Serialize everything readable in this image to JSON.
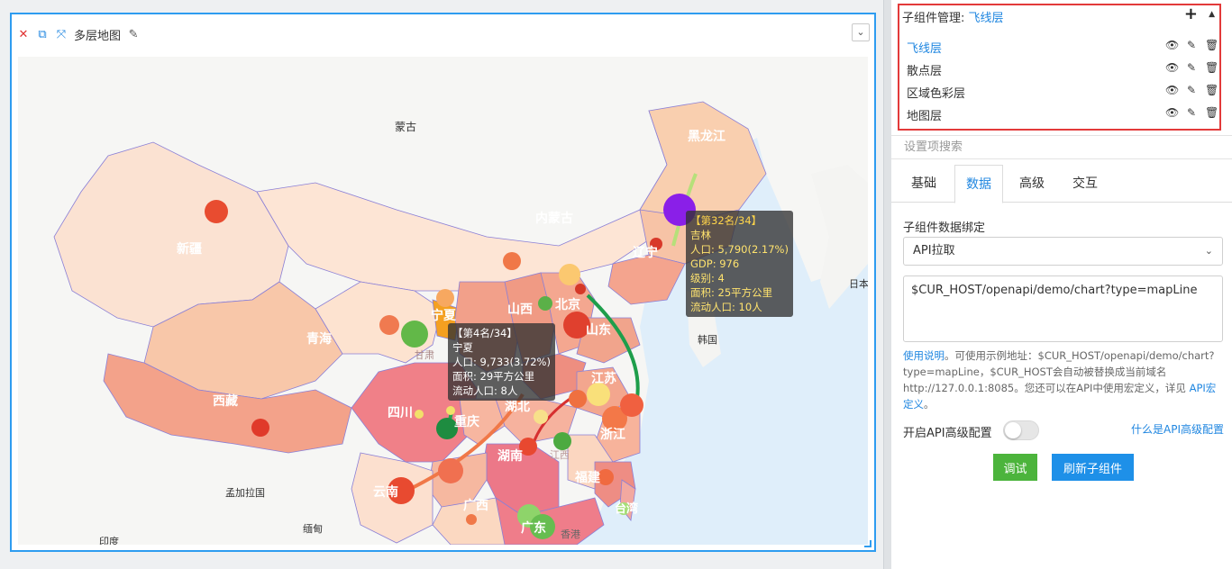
{
  "widget": {
    "title": "多层地图",
    "icons": {
      "close": "close-icon",
      "copy": "copy-icon",
      "fullscreen": "expand-icon",
      "edit": "pencil-icon",
      "collapse": "chevron-down-icon"
    }
  },
  "map": {
    "place_labels": [
      "蒙古",
      "新疆",
      "内蒙古",
      "黑龙江",
      "辽宁",
      "青海",
      "宁夏",
      "甘肃",
      "山西",
      "北京",
      "山东",
      "西藏",
      "四川",
      "重庆",
      "湖北",
      "江苏",
      "浙江",
      "湖南",
      "江西",
      "福建",
      "云南",
      "广西",
      "广东",
      "台湾",
      "香港",
      "日本",
      "韩国",
      "孟加拉国",
      "缅甸",
      "印度"
    ],
    "tooltips": [
      {
        "head": "【第32名/34】",
        "lines": [
          "吉林",
          "人口: 5,790(2.17%)",
          "GDP: 976",
          "级别: 4",
          "面积: 25平方公里",
          "流动人口: 10人"
        ]
      },
      {
        "head": "【第4名/34】",
        "lines": [
          "宁夏",
          "人口: 9,733(3.72%)",
          "面积: 29平方公里",
          "流动人口: 8人"
        ]
      }
    ]
  },
  "panel": {
    "sub_manager": {
      "label": "子组件管理:",
      "current": "飞线层",
      "icons": {
        "add": "plus-icon",
        "sort": "caret-up-icon",
        "view": "eye-icon",
        "edit": "edit-icon",
        "delete": "trash-icon"
      },
      "layers": [
        {
          "name": "飞线层",
          "active": true
        },
        {
          "name": "散点层",
          "active": false
        },
        {
          "name": "区域色彩层",
          "active": false
        },
        {
          "name": "地图层",
          "active": false
        }
      ]
    },
    "search_placeholder": "设置项搜索",
    "tabs": [
      "基础",
      "数据",
      "高级",
      "交互"
    ],
    "active_tab": "数据",
    "bind_label": "子组件数据绑定",
    "bind_select": "API拉取",
    "api_url": "$CUR_HOST/openapi/demo/chart?type=mapLine",
    "help_link": "使用说明",
    "help_text": "。可使用示例地址：$CUR_HOST/openapi/demo/chart?type=mapLine，$CUR_HOST会自动被替换成当前域名http://127.0.0.1:8085。您还可以在API中使用宏定义，详见 ",
    "help_link2": "API宏定义",
    "help_end": "。",
    "adv_label": "开启API高级配置",
    "adv_enabled": false,
    "adv_link": "什么是API高级配置",
    "debug_button": "调试",
    "refresh_button": "刷新子组件"
  }
}
